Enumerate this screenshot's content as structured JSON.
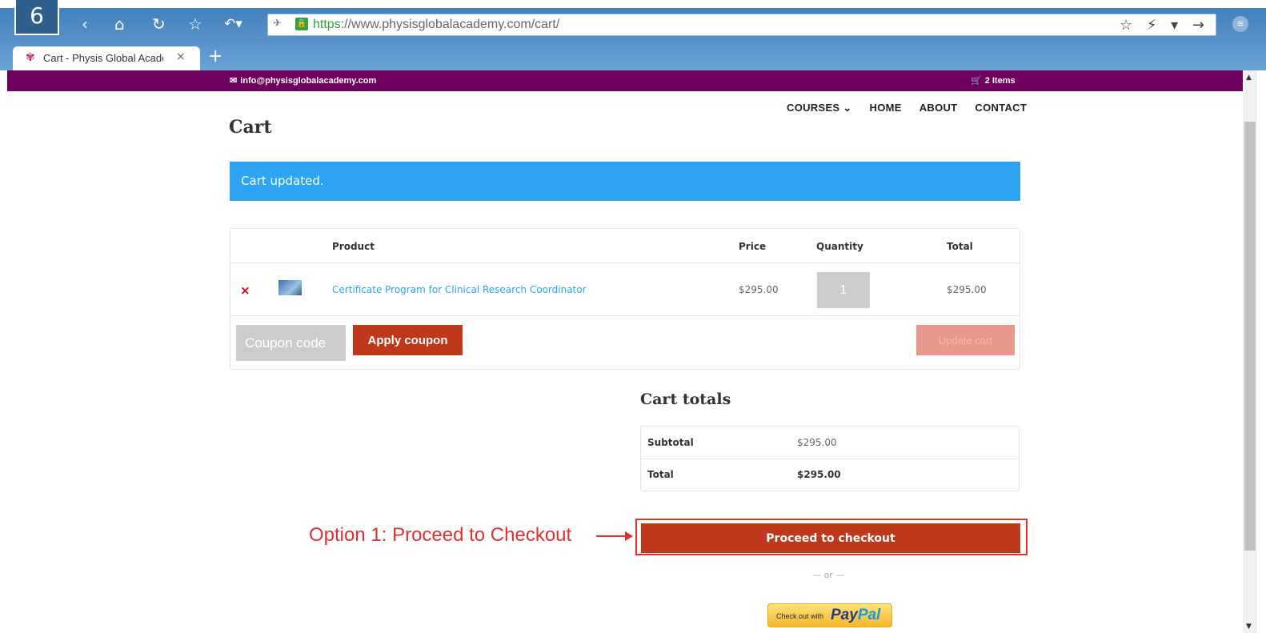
{
  "browser": {
    "logo_glyph": "6",
    "nav": {
      "back": "‹",
      "home": "⌂",
      "reload": "↻",
      "bookmark": "☆",
      "undo": "↶▾"
    },
    "url_scheme": "https",
    "url_rest": "://www.physisglobalacademy.com/cart/",
    "addr_right_icons": "☆ ⚡ ▾ →",
    "tab_title": "Cart - Physis Global Academy",
    "tab_close": "×",
    "new_tab": "+",
    "menu_glyph": "≋"
  },
  "topbar": {
    "email": "info@physisglobalacademy.com",
    "cart_count": "2 Items",
    "bg_color": "#6e005e"
  },
  "nav": {
    "items": [
      "COURSES ⌄",
      "HOME",
      "ABOUT",
      "CONTACT"
    ]
  },
  "page": {
    "title": "Cart",
    "notice": "Cart updated."
  },
  "cart": {
    "headers": {
      "product": "Product",
      "price": "Price",
      "quantity": "Quantity",
      "total": "Total"
    },
    "rows": [
      {
        "remove": "×",
        "product": "Certificate Program for Clinical Research Coordinator",
        "price": "$295.00",
        "quantity": "1",
        "total": "$295.00"
      }
    ],
    "coupon_placeholder": "Coupon code",
    "apply_label": "Apply coupon",
    "update_label": "Update cart"
  },
  "totals": {
    "title": "Cart totals",
    "subtotal_label": "Subtotal",
    "subtotal_value": "$295.00",
    "total_label": "Total",
    "total_value": "$295.00"
  },
  "checkout": {
    "annotation": "Option 1: Proceed to Checkout",
    "button_label": "Proceed to checkout",
    "or_text": "— or —",
    "paypal_small": "Check out with",
    "paypal_pay": "Pay",
    "paypal_pal": "Pal"
  },
  "colors": {
    "accent": "#2ea3f2",
    "button": "#c0381c",
    "annotation": "#e03030"
  }
}
